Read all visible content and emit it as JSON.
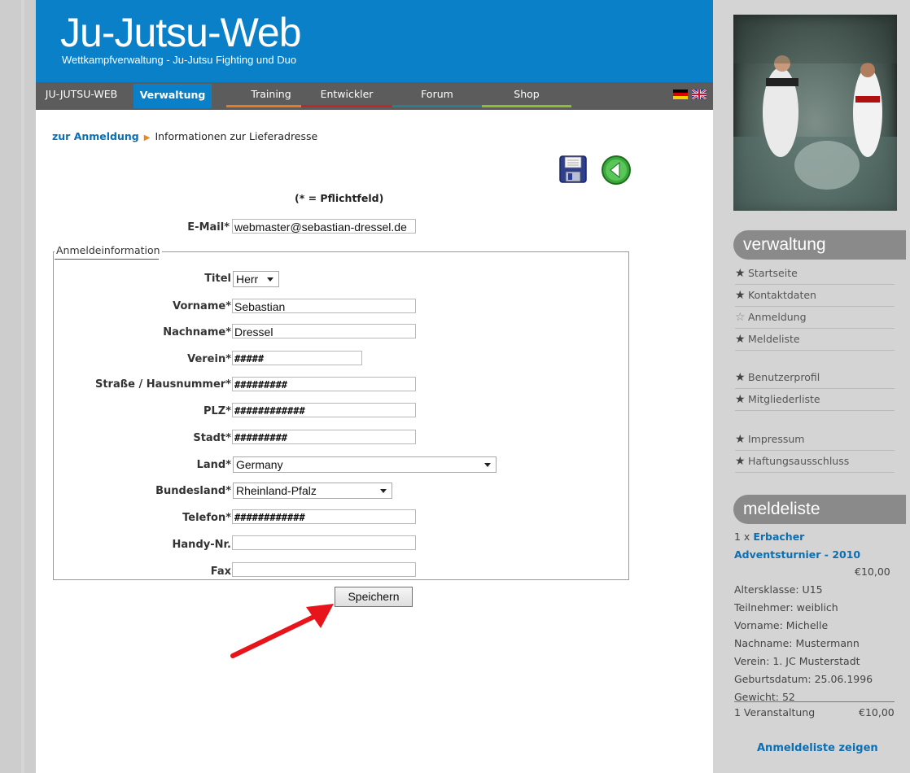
{
  "header": {
    "logo": "Ju-Jutsu-Web",
    "tagline": "Wettkampfverwaltung - Ju-Jutsu Fighting und Duo"
  },
  "nav": {
    "items": [
      {
        "label": "JU-JUTSU-WEB",
        "color": ""
      },
      {
        "label": "Verwaltung",
        "color": "#0a80c9"
      },
      {
        "label": "Training",
        "color": "#e87b1e"
      },
      {
        "label": "Entwickler",
        "color": "#c0262c"
      },
      {
        "label": "Forum",
        "color": "#2f7c8c"
      },
      {
        "label": "Shop",
        "color": "#8bbf2c"
      }
    ],
    "flags": [
      "de-flag-icon",
      "uk-flag-icon"
    ]
  },
  "breadcrumb": {
    "link": "zur Anmeldung",
    "current": "Informationen zur Lieferadresse"
  },
  "form": {
    "required_note": "(* = Pflichtfeld)",
    "email_label": "E-Mail*",
    "email_value": "webmaster@sebastian-dressel.de",
    "legend": "Anmeldeinformation",
    "fields": {
      "titel": {
        "label": "Titel",
        "value": "Herr"
      },
      "vorname": {
        "label": "Vorname*",
        "value": "Sebastian"
      },
      "nachname": {
        "label": "Nachname*",
        "value": "Dressel"
      },
      "verein": {
        "label": "Verein*",
        "value": "#####"
      },
      "strasse": {
        "label": "Straße / Hausnummer*",
        "value": "#########"
      },
      "plz": {
        "label": "PLZ*",
        "value": "############"
      },
      "stadt": {
        "label": "Stadt*",
        "value": "#########"
      },
      "land": {
        "label": "Land*",
        "value": "Germany"
      },
      "bundesland": {
        "label": "Bundesland*",
        "value": "Rheinland-Pfalz"
      },
      "telefon": {
        "label": "Telefon*",
        "value": "############"
      },
      "handy": {
        "label": "Handy-Nr.",
        "value": ""
      },
      "fax": {
        "label": "Fax",
        "value": ""
      }
    },
    "save_label": "Speichern"
  },
  "sidebar": {
    "verwaltung_title": "verwaltung",
    "menu": [
      {
        "label": "Startseite",
        "icon": "star-icon"
      },
      {
        "label": "Kontaktdaten",
        "icon": "star-icon"
      },
      {
        "label": "Anmeldung",
        "icon": "star-outline-icon"
      },
      {
        "label": "Meldeliste",
        "icon": "star-icon"
      },
      {
        "label": "Benutzerprofil",
        "icon": "star-icon"
      },
      {
        "label": "Mitgliederliste",
        "icon": "star-icon"
      },
      {
        "label": "Impressum",
        "icon": "star-icon"
      },
      {
        "label": "Haftungsausschluss",
        "icon": "star-icon"
      }
    ],
    "meldeliste_title": "meldeliste",
    "meldeliste": {
      "count_prefix": "1 x",
      "event_line1": "Erbacher",
      "event_line2": "Adventsturnier - 2010",
      "price": "€10,00",
      "details": [
        "Altersklasse: U15",
        "Teilnehmer: weiblich",
        "Vorname: Michelle",
        "Nachname: Mustermann",
        "Verein: 1. JC Musterstadt",
        "Geburtsdatum: 25.06.1996",
        "Gewicht: 52"
      ],
      "summary_label": "1 Veranstaltung",
      "summary_price": "€10,00",
      "show_link": "Anmeldeliste zeigen"
    }
  }
}
